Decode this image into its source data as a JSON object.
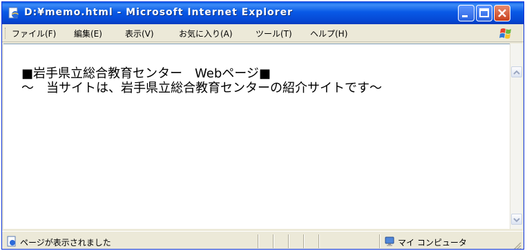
{
  "window": {
    "title": "D:¥memo.html - Microsoft Internet Explorer"
  },
  "menubar": {
    "items": [
      {
        "label": "ファイル(F)"
      },
      {
        "label": "編集(E)"
      },
      {
        "label": "表示(V)"
      },
      {
        "label": "お気に入り(A)"
      },
      {
        "label": "ツール(T)"
      },
      {
        "label": "ヘルプ(H)"
      }
    ]
  },
  "content": {
    "line1": "■岩手県立総合教育センター　Webページ■",
    "line2": "～　当サイトは、岩手県立総合教育センターの紹介サイトです～"
  },
  "statusbar": {
    "status_text": "ページが表示されました",
    "zone_text": "マイ コンピュータ"
  },
  "colors": {
    "titlebar": "#0a5fe6",
    "close_button": "#c9401b",
    "chrome": "#ece9d8"
  },
  "icons": {
    "app": "ie-page-icon",
    "logo": "windows-flag-icon",
    "status": "page-done-icon",
    "zone": "my-computer-icon"
  }
}
